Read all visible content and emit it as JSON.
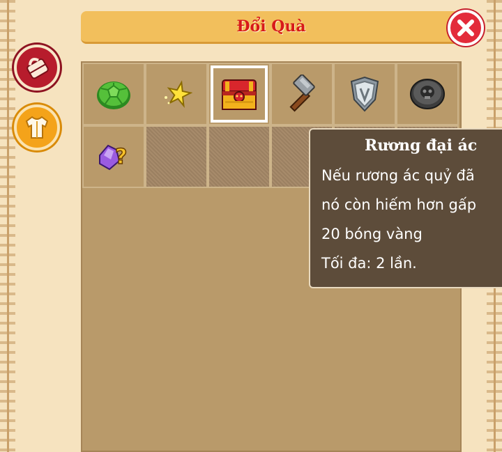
{
  "window": {
    "title": "Đổi Quà"
  },
  "side_buttons": [
    {
      "icon": "bag-icon",
      "color": "#b71c2c"
    },
    {
      "icon": "shirt-icon",
      "color": "#f4a31a"
    }
  ],
  "inventory": {
    "row1": [
      "turtle-shell-icon",
      "star-icon",
      "treasure-chest-icon",
      "hammer-icon",
      "shield-icon",
      "skull-coin-icon"
    ],
    "row2": [
      "mystery-gem-icon",
      "empty",
      "empty",
      "empty",
      "empty",
      "empty"
    ],
    "selected_item": "treasure-chest-icon"
  },
  "tooltip": {
    "title": "Rương đại ác",
    "lines": [
      "Nếu rương ác quỷ đã",
      "nó còn hiếm hơn gấp",
      "20 bóng vàng",
      "Tối đa: 2 lần."
    ]
  },
  "colors": {
    "title_text": "#d71a1a",
    "title_bar": "#f2bf5c",
    "panel": "#b99a6a",
    "tooltip_bg": "#5d4c3a"
  }
}
